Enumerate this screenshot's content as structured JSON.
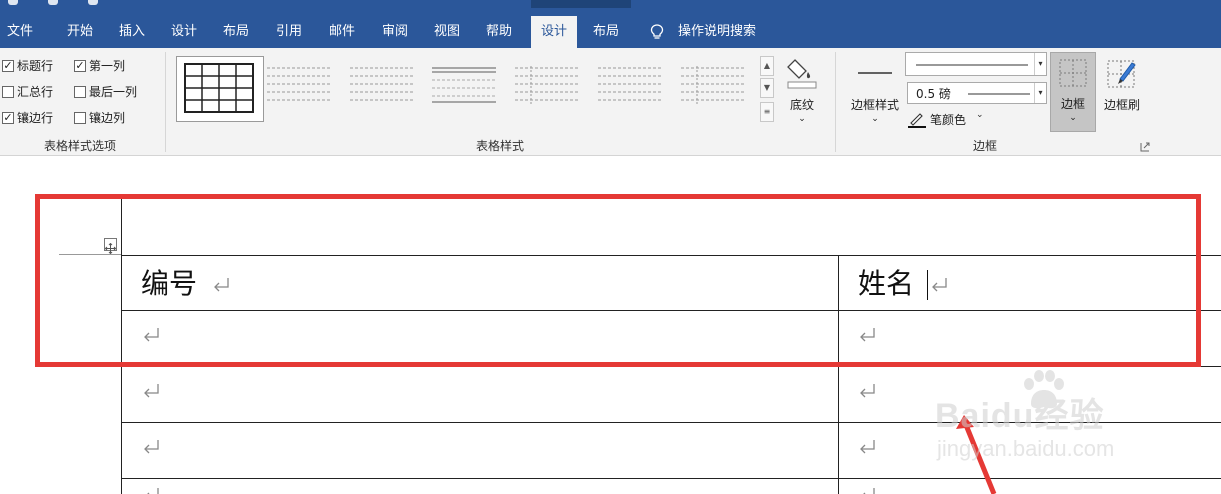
{
  "menu": {
    "tabs": [
      {
        "label": "文件"
      },
      {
        "label": "开始"
      },
      {
        "label": "插入"
      },
      {
        "label": "设计"
      },
      {
        "label": "布局"
      },
      {
        "label": "引用"
      },
      {
        "label": "邮件"
      },
      {
        "label": "审阅"
      },
      {
        "label": "视图"
      },
      {
        "label": "帮助"
      },
      {
        "label": "设计"
      },
      {
        "label": "布局"
      }
    ],
    "active_tab_index": 10,
    "search_label": "操作说明搜索"
  },
  "ribbon": {
    "style_options": {
      "items": [
        {
          "label": "标题行",
          "checked": true
        },
        {
          "label": "第一列",
          "checked": true
        },
        {
          "label": "汇总行",
          "checked": false
        },
        {
          "label": "最后一列",
          "checked": false
        },
        {
          "label": "镶边行",
          "checked": true
        },
        {
          "label": "镶边列",
          "checked": false
        }
      ],
      "group_label": "表格样式选项"
    },
    "table_styles": {
      "group_label": "表格样式",
      "shading_label": "底纹"
    },
    "borders": {
      "group_label": "边框",
      "border_styles_label": "边框样式",
      "weight_value": "0.5 磅",
      "pen_color_label": "笔颜色",
      "borders_label": "边框",
      "border_painter_label": "边框刷"
    }
  },
  "document": {
    "table": {
      "header": [
        "编号",
        "姓名"
      ]
    }
  },
  "watermark": {
    "brand": "Baidu经验",
    "url": "jingyan.baidu.com"
  },
  "colors": {
    "ribbon_blue": "#2b579a",
    "highlight_red": "#e53935"
  }
}
